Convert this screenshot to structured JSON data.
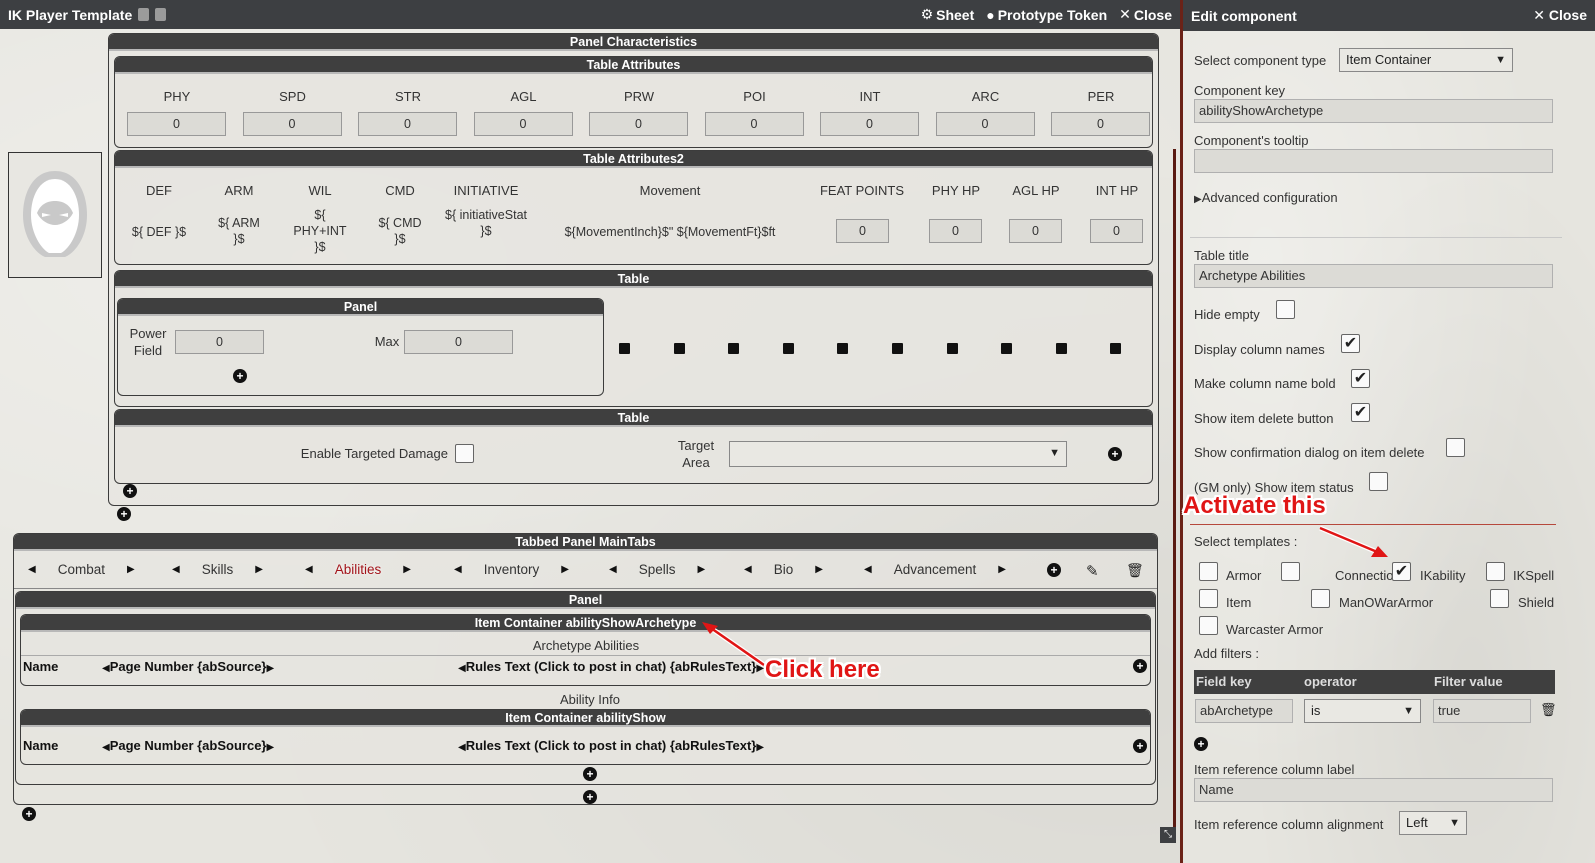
{
  "topbar": {
    "title": "IK Player Template",
    "sheet": "Sheet",
    "prototype_token": "Prototype Token",
    "close": "Close"
  },
  "characteristics": {
    "title": "Panel Characteristics",
    "attributes_title": "Table Attributes",
    "attributes": [
      {
        "label": "PHY",
        "value": "0"
      },
      {
        "label": "SPD",
        "value": "0"
      },
      {
        "label": "STR",
        "value": "0"
      },
      {
        "label": "AGL",
        "value": "0"
      },
      {
        "label": "PRW",
        "value": "0"
      },
      {
        "label": "POI",
        "value": "0"
      },
      {
        "label": "INT",
        "value": "0"
      },
      {
        "label": "ARC",
        "value": "0"
      },
      {
        "label": "PER",
        "value": "0"
      }
    ],
    "attributes2_title": "Table Attributes2",
    "attributes2_headers": [
      "DEF",
      "ARM",
      "WIL",
      "CMD",
      "INITIATIVE",
      "Movement",
      "FEAT POINTS",
      "PHY HP",
      "AGL HP",
      "INT HP"
    ],
    "attributes2_values": {
      "def": "${ DEF }$",
      "arm": "${ ARM }$",
      "wil": "${ PHY+INT }$",
      "cmd": "${ CMD }$",
      "initiative": "${ initiativeStat }$",
      "movement": "${MovementInch}$\" ${MovementFt}$ft",
      "feat_points": "0",
      "phy_hp": "0",
      "agl_hp": "0",
      "int_hp": "0"
    },
    "table_title": "Table",
    "inner_panel_title": "Panel",
    "power_field_label": "Power Field",
    "power_field_value": "0",
    "max_label": "Max",
    "max_value": "0",
    "table2_title": "Table",
    "enable_targeted_damage": "Enable Targeted Damage",
    "target_area": "Target Area"
  },
  "tabs": {
    "title": "Tabbed Panel MainTabs",
    "items": [
      "Combat",
      "Skills",
      "Abilities",
      "Inventory",
      "Spells",
      "Bio",
      "Advancement"
    ],
    "active": "Abilities"
  },
  "abilities_panel": {
    "title": "Panel",
    "container1_title": "Item Container abilityShowArchetype",
    "container1_caption": "Archetype Abilities",
    "container2_caption": "Ability Info",
    "container2_title": "Item Container abilityShow",
    "col_name": "Name",
    "col_page": "Page Number {abSource}",
    "col_rules": "Rules Text (Click to post in chat) {abRulesText}"
  },
  "annotations": {
    "click_here": "Click here",
    "activate_this": "Activate this"
  },
  "editor": {
    "title": "Edit component",
    "close": "Close",
    "component_type_label": "Select component type",
    "component_type_value": "Item Container",
    "component_key_label": "Component key",
    "component_key_value": "abilityShowArchetype",
    "tooltip_label": "Component's tooltip",
    "tooltip_value": "",
    "advanced_config": "Advanced configuration",
    "table_title_label": "Table title",
    "table_title_value": "Archetype Abilities",
    "hide_empty": "Hide empty",
    "display_column_names": "Display column names",
    "bold_column_name": "Make column name bold",
    "show_delete_button": "Show item delete button",
    "confirm_delete": "Show confirmation dialog on item delete",
    "gm_item_status": "(GM only) Show item status",
    "select_templates_label": "Select templates :",
    "templates": [
      {
        "name": "Armor",
        "checked": false
      },
      {
        "name": "Connection",
        "checked": false
      },
      {
        "name": "IKability",
        "checked": true
      },
      {
        "name": "IKSpell",
        "checked": false
      },
      {
        "name": "Item",
        "checked": false
      },
      {
        "name": "ManOWarArmor",
        "checked": false
      },
      {
        "name": "Shield",
        "checked": false
      },
      {
        "name": "Warcaster Armor",
        "checked": false
      }
    ],
    "add_filters_label": "Add filters :",
    "filter_headers": [
      "Field key",
      "operator",
      "Filter value"
    ],
    "filter_row": {
      "field_key": "abArchetype",
      "operator": "is",
      "value": "true"
    },
    "item_ref_col_label_label": "Item reference column label",
    "item_ref_col_label_value": "Name",
    "item_ref_alignment_label": "Item reference column alignment",
    "item_ref_alignment_value": "Left"
  },
  "colors": {
    "header_dark": "#3d3f42",
    "accent_red": "#a3141a",
    "annotation_red": "#e01515"
  }
}
